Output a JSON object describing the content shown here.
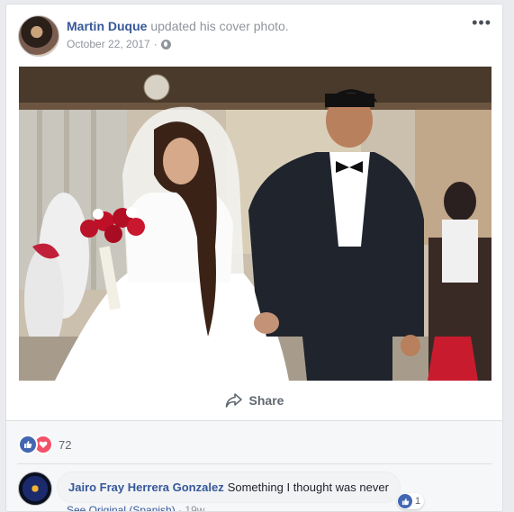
{
  "post": {
    "author": "Martin Duque",
    "action": "updated his cover photo.",
    "date": "October 22, 2017",
    "separator": "·",
    "more_icon": "ellipsis-icon",
    "privacy_icon": "globe-icon",
    "more_glyph": "•••"
  },
  "actions": {
    "share_label": "Share",
    "share_icon": "share-arrow-icon"
  },
  "reactions": {
    "count": "72",
    "types": [
      "like",
      "love"
    ]
  },
  "comment": {
    "author": "Jairo Fray Herrera Gonzalez",
    "text": "Something I thought was never",
    "likes": "1",
    "see_original": "See Original (Spanish)",
    "separator": "·",
    "age": "19w"
  },
  "colors": {
    "link": "#365899",
    "meta": "#90949c",
    "like": "#4267b2",
    "love": "#f25268"
  }
}
